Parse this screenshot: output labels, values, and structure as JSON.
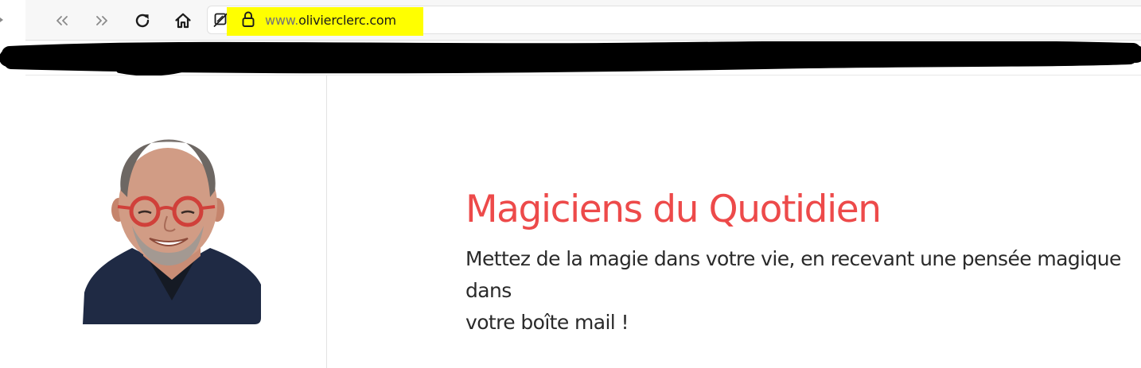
{
  "browser": {
    "url_prefix": "www.",
    "url_domain": "olivierclerc.com",
    "highlight_color": "#ffff00",
    "icons": {
      "back": "double-chevron-left-icon",
      "forward": "double-chevron-right-icon",
      "reload": "reload-icon",
      "home": "home-icon",
      "tracking": "tracking-protection-shield-icon",
      "lock": "lock-icon"
    }
  },
  "bookmarks_bar": {
    "redacted": true,
    "redaction_color": "#000000"
  },
  "page": {
    "headline": "Magiciens du Quotidien",
    "tagline_line1": "Mettez de la magie dans votre vie, en recevant une pensée magique dans",
    "tagline_line2": "votre boîte mail !",
    "accent_color": "#ed4a4a",
    "portrait": "author-portrait"
  }
}
